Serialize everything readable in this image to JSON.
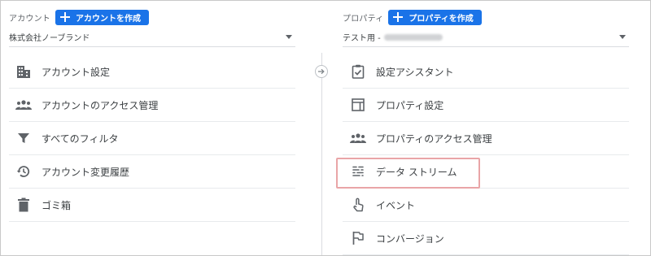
{
  "account_column": {
    "header_label": "アカウント",
    "create_button_label": "アカウントを作成",
    "selector_value": "株式会社ノーブランド",
    "menu_items": [
      {
        "label": "アカウント設定",
        "icon": "building-icon"
      },
      {
        "label": "アカウントのアクセス管理",
        "icon": "people-icon"
      },
      {
        "label": "すべてのフィルタ",
        "icon": "filter-icon"
      },
      {
        "label": "アカウント変更履歴",
        "icon": "history-icon"
      },
      {
        "label": "ゴミ箱",
        "icon": "trash-icon"
      }
    ]
  },
  "property_column": {
    "header_label": "プロパティ",
    "create_button_label": "プロパティを作成",
    "selector_value": "テスト用 -",
    "menu_items": [
      {
        "label": "設定アシスタント",
        "icon": "clipboard-check-icon"
      },
      {
        "label": "プロパティ設定",
        "icon": "layout-icon"
      },
      {
        "label": "プロパティのアクセス管理",
        "icon": "people-icon"
      },
      {
        "label": "データ ストリーム",
        "icon": "data-stream-icon"
      },
      {
        "label": "イベント",
        "icon": "touch-icon"
      },
      {
        "label": "コンバージョン",
        "icon": "flag-icon"
      }
    ]
  },
  "colors": {
    "accent": "#1a73e8",
    "icon": "#5f6368",
    "highlight_border": "#e9a5a7"
  }
}
